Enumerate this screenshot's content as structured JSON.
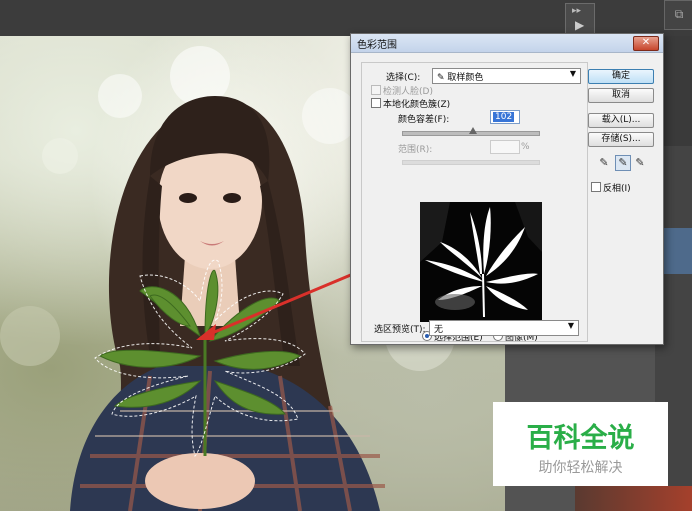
{
  "dialog": {
    "title": "色彩范围",
    "close_glyph": "✕",
    "select_label": "选择(C):",
    "select_icon": "eyedropper-icon",
    "select_value": "取样颜色",
    "detect_faces_label": "检测人脸(D)",
    "detect_faces_checked": false,
    "localized_clusters_label": "本地化颜色簇(Z)",
    "localized_clusters_checked": false,
    "fuzziness_label": "颜色容差(F):",
    "fuzziness_value": "102",
    "range_label": "范围(R):",
    "range_unit": "%",
    "view_selection_label": "选择范围(E)",
    "view_image_label": "图像(M)",
    "view_mode_selected": "选择范围(E)",
    "preview_label": "选区预览(T):",
    "preview_value": "无",
    "ok_label": "确定",
    "cancel_label": "取消",
    "load_label": "载入(L)...",
    "save_label": "存储(S)...",
    "invert_label": "反相(I)",
    "invert_checked": false,
    "droppers": [
      "eyedropper-icon",
      "eyedropper-plus-icon",
      "eyedropper-minus-icon"
    ]
  },
  "toolbar": {
    "play_glyph": "▶",
    "collapse_glyph": "▸▸",
    "corner_glyph": "⧉"
  },
  "watermark": {
    "brand": "百科全说",
    "slogan": "助你轻松解决"
  },
  "colors": {
    "arrow": "#d9302a",
    "brand_green": "#2aae48",
    "selection_blue": "#3875d7"
  }
}
